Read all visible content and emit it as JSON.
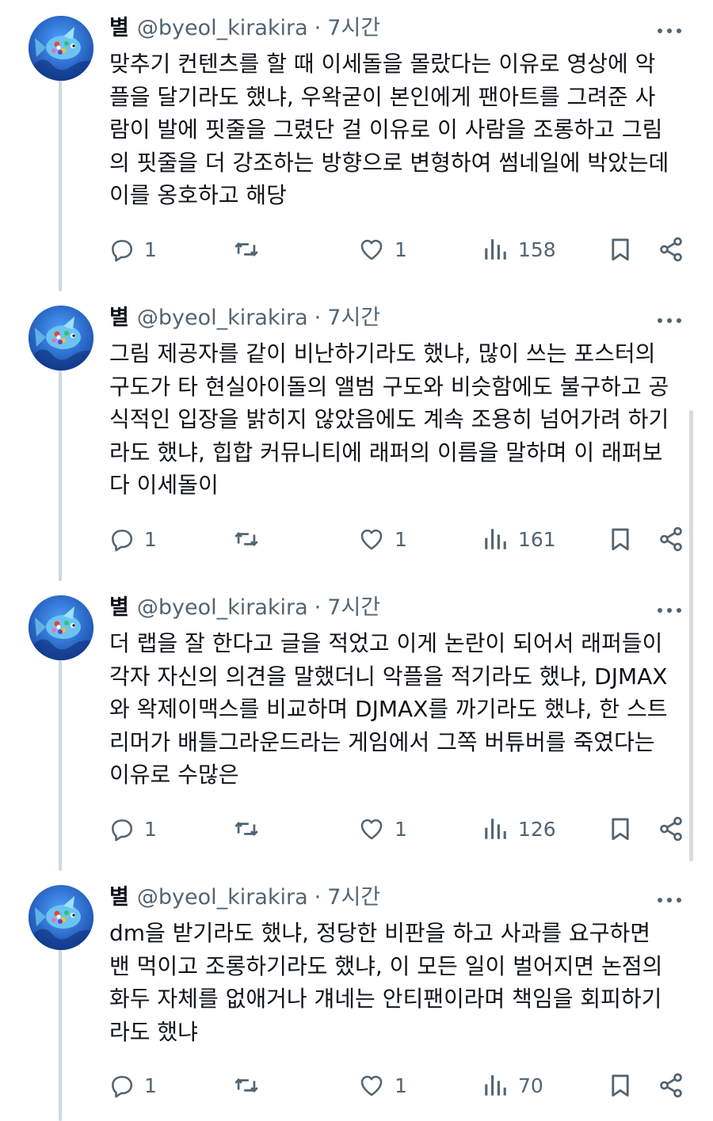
{
  "posts": [
    {
      "name": "별",
      "handle": "@byeol_kirakira",
      "dot": "·",
      "time": "7시간",
      "lines": [
        "맞추기 컨텐츠를 할 때 이세돌을 몰랐다는 이유로 영상에 악",
        "플을 달기라도 했냐, 우왁굳이 본인에게 팬아트를 그려준 사",
        "람이 발에 핏줄을 그렸단 걸 이유로 이 사람을 조롱하고 그림",
        "의 핏줄을 더 강조하는 방향으로 변형하여 썸네일에 박았는데",
        "이를 옹호하고 해당"
      ],
      "replies": "1",
      "likes": "1",
      "views": "158"
    },
    {
      "name": "별",
      "handle": "@byeol_kirakira",
      "dot": "·",
      "time": "7시간",
      "lines": [
        "그림 제공자를 같이 비난하기라도 했냐, 많이 쓰는 포스터의",
        "구도가 타 현실아이돌의 앨범 구도와 비슷함에도 불구하고 공",
        "식적인 입장을 밝히지 않았음에도 계속 조용히 넘어가려 하기",
        "라도 했냐, 힙합 커뮤니티에 래퍼의 이름을 말하며 이 래퍼보",
        "다 이세돌이"
      ],
      "replies": "1",
      "likes": "1",
      "views": "161"
    },
    {
      "name": "별",
      "handle": "@byeol_kirakira",
      "dot": "·",
      "time": "7시간",
      "lines": [
        "더 랩을 잘 한다고 글을 적었고 이게 논란이 되어서 래퍼들이",
        "각자 자신의 의견을 말했더니 악플을 적기라도 했냐, DJMAX",
        "와 왁제이맥스를 비교하며 DJMAX를 까기라도 했냐, 한 스트",
        "리머가 배틀그라운드라는 게임에서 그쪽 버튜버를 죽였다는",
        "이유로 수많은"
      ],
      "replies": "1",
      "likes": "1",
      "views": "126"
    },
    {
      "name": "별",
      "handle": "@byeol_kirakira",
      "dot": "·",
      "time": "7시간",
      "lines": [
        "dm을 받기라도 했냐, 정당한 비판을 하고 사과를 요구하면",
        "밴 먹이고 조롱하기라도 했냐, 이 모든 일이 벌어지면 논점의",
        "화두 자체를 없애거나 걔네는 안티팬이라며 책임을 회피하기",
        "라도 했냐"
      ],
      "replies": "1",
      "likes": "1",
      "views": "70"
    }
  ],
  "icons": {
    "reply": "reply-icon",
    "repost": "repost-icon",
    "like": "heart-icon",
    "views": "views-icon",
    "bookmark": "bookmark-icon",
    "share": "share-icon",
    "more": "more-icon"
  },
  "colors": {
    "text": "#0f1419",
    "secondary": "#536471",
    "thread_line": "#cfd9de"
  }
}
